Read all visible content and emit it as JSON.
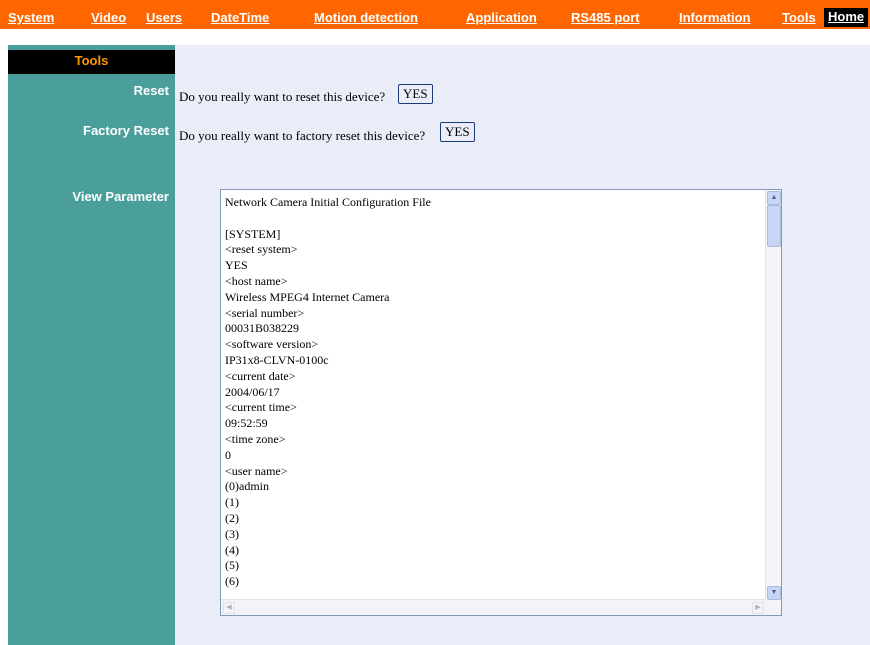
{
  "nav": {
    "items": [
      "System",
      "Video",
      "Users",
      "DateTime",
      "Motion detection",
      "Application",
      "RS485 port",
      "Information",
      "Tools"
    ],
    "home": "Home"
  },
  "sidebar": {
    "header": "Tools",
    "reset_label": "Reset",
    "factory_reset_label": "Factory Reset",
    "view_parameter_label": "View Parameter"
  },
  "main": {
    "reset_question": "Do you really want to reset this device?",
    "reset_button": "YES",
    "factory_question": "Do you really want to factory reset this device?",
    "factory_button": "YES",
    "parameters_text": "Network Camera Initial Configuration File\n\n[SYSTEM]\n<reset system>\nYES\n<host name>\nWireless MPEG4 Internet Camera\n<serial number>\n00031B038229\n<software version>\nIP31x8-CLVN-0100c\n<current date>\n2004/06/17\n<current time>\n09:52:59\n<time zone>\n0\n<user name>\n(0)admin\n(1)\n(2)\n(3)\n(4)\n(5)\n(6)"
  },
  "colors": {
    "topbar": "#ff6600",
    "sidebar": "#4a9f9b",
    "content_bg": "#eaecf7",
    "sidebar_header_text": "#ff9900"
  }
}
